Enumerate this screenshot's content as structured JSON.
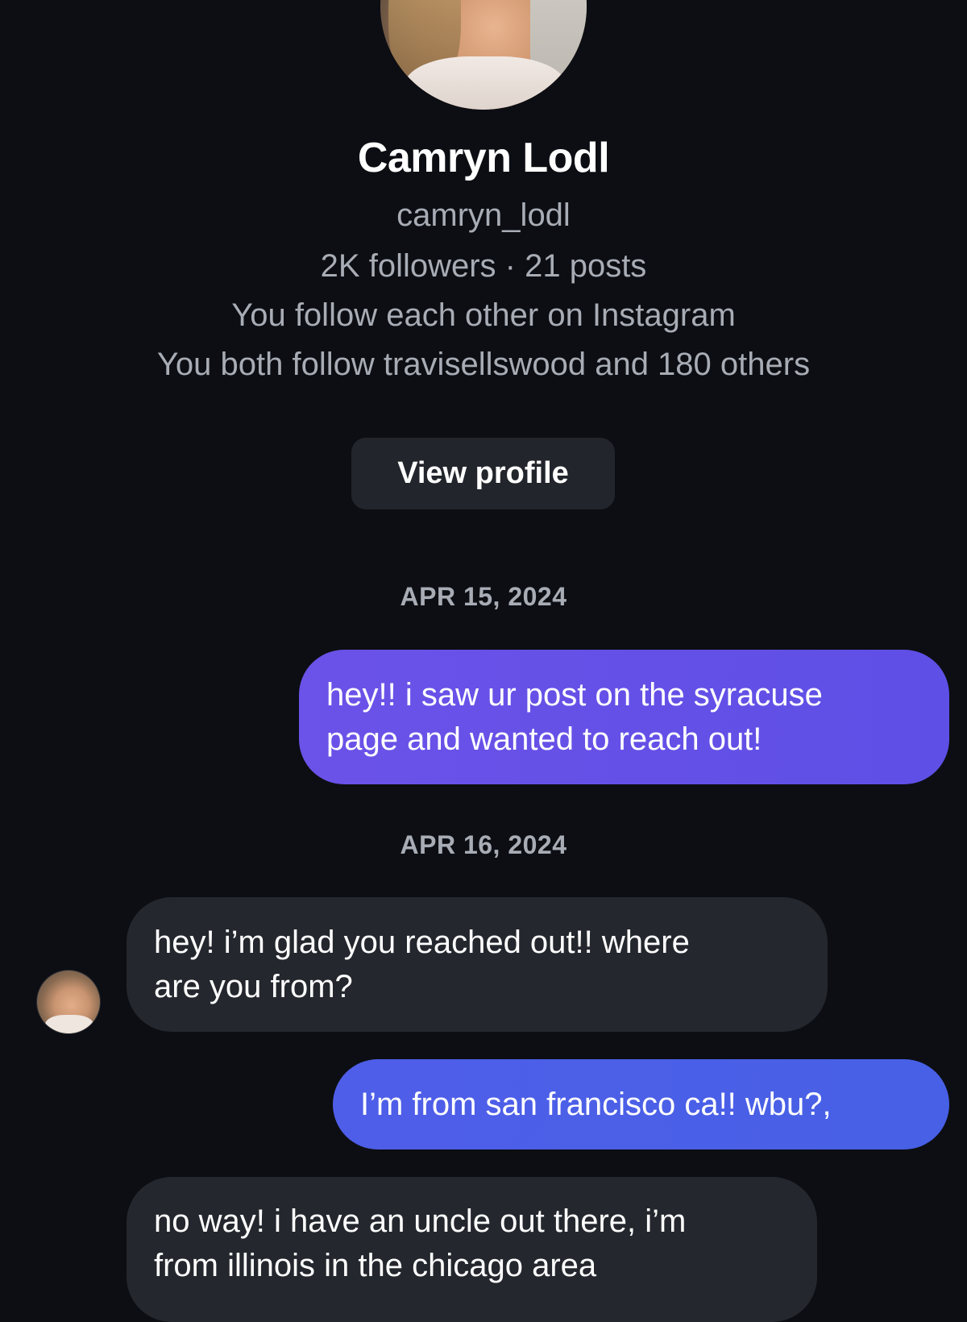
{
  "profile": {
    "name": "Camryn Lodl",
    "username": "camryn_lodl",
    "stats": "2K followers · 21 posts",
    "follow_status": "You follow each other on Instagram",
    "mutuals": "You both follow travisellswood and 180 others",
    "view_profile_label": "View profile"
  },
  "conversation": {
    "dates": [
      "APR 15, 2024",
      "APR 16, 2024"
    ],
    "messages": [
      {
        "direction": "outgoing",
        "lines": [
          "hey!! i saw ur post on the syracuse",
          "page and wanted to reach out!"
        ]
      },
      {
        "direction": "incoming",
        "lines": [
          "hey! i’m glad you reached out!! where",
          "are you from?"
        ]
      },
      {
        "direction": "outgoing",
        "lines": [
          "I’m from san francisco ca!! wbu?,"
        ]
      },
      {
        "direction": "incoming",
        "lines": [
          "no way! i have an uncle out there, i’m",
          "from illinois in the chicago area"
        ]
      }
    ]
  },
  "colors": {
    "background": "#0c0e13",
    "outgoing_bubble_1": "#6b52e8",
    "outgoing_bubble_2": "#4f5ee8",
    "incoming_bubble": "#24272d",
    "secondary_text": "#a8acb5"
  }
}
